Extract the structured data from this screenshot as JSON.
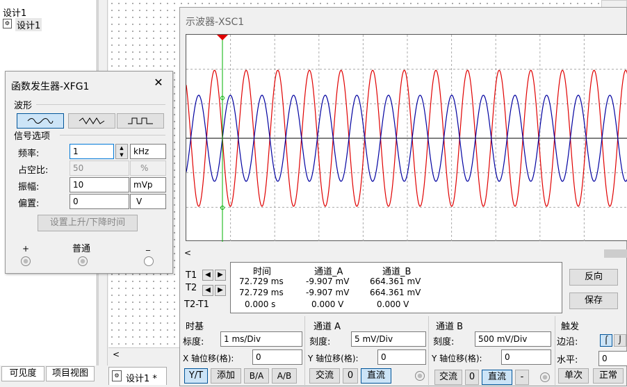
{
  "project_tree": {
    "root": "设计1",
    "child": "设计1"
  },
  "bottom_tabs": [
    "可见度",
    "项目视图"
  ],
  "doc_tab": "设计1 *",
  "fg": {
    "title": "函数发生器-XFG1",
    "waveform_label": "波形",
    "signal_label": "信号选项",
    "freq_label": "频率:",
    "freq_value": "1",
    "freq_unit": "kHz",
    "duty_label": "占空比:",
    "duty_value": "50",
    "duty_unit": "%",
    "amp_label": "振幅:",
    "amp_value": "10",
    "amp_unit": "mVp",
    "offset_label": "偏置:",
    "offset_value": "0",
    "offset_unit": "V",
    "rise_fall_button": "设置上升/下降时间",
    "plus": "+",
    "common": "普通",
    "minus": "_",
    "close_icon": "close-icon"
  },
  "osc": {
    "title": "示波器-XSC1",
    "trace_colors": {
      "channel_a": "#0000a0",
      "channel_b": "#e00000",
      "cursor": "#00b000"
    },
    "readout": {
      "headers": [
        "时间",
        "通道_A",
        "通道_B"
      ],
      "t1": {
        "label": "T1",
        "time": "72.729 ms",
        "a": "-9.907 mV",
        "b": "664.361 mV"
      },
      "t2": {
        "label": "T2",
        "time": "72.729 ms",
        "a": "-9.907 mV",
        "b": "664.361 mV"
      },
      "t2t1": {
        "label": "T2-T1",
        "time": "0.000 s",
        "a": "0.000 V",
        "b": "0.000 V"
      }
    },
    "reverse_button": "反向",
    "save_button": "保存",
    "timebase": {
      "title": "时基",
      "scale_label": "标度:",
      "scale_value": "1 ms/Div",
      "xpos_label": "X 轴位移(格):",
      "xpos_value": "0",
      "modes": [
        "Y/T",
        "添加",
        "B/A",
        "A/B"
      ]
    },
    "channel_a": {
      "title": "通道 A",
      "scale_label": "刻度:",
      "scale_value": "5 mV/Div",
      "ypos_label": "Y 轴位移(格):",
      "ypos_value": "0",
      "coupling": [
        "交流",
        "0",
        "直流"
      ]
    },
    "channel_b": {
      "title": "通道 B",
      "scale_label": "刻度:",
      "scale_value": "500 mV/Div",
      "ypos_label": "Y 轴位移(格):",
      "ypos_value": "0",
      "coupling": [
        "交流",
        "0",
        "直流",
        "-"
      ]
    },
    "trigger": {
      "title": "触发",
      "edge_label": "边沿:",
      "level_label": "水平:",
      "level_value": "0",
      "modes": [
        "单次",
        "正常"
      ]
    }
  }
}
